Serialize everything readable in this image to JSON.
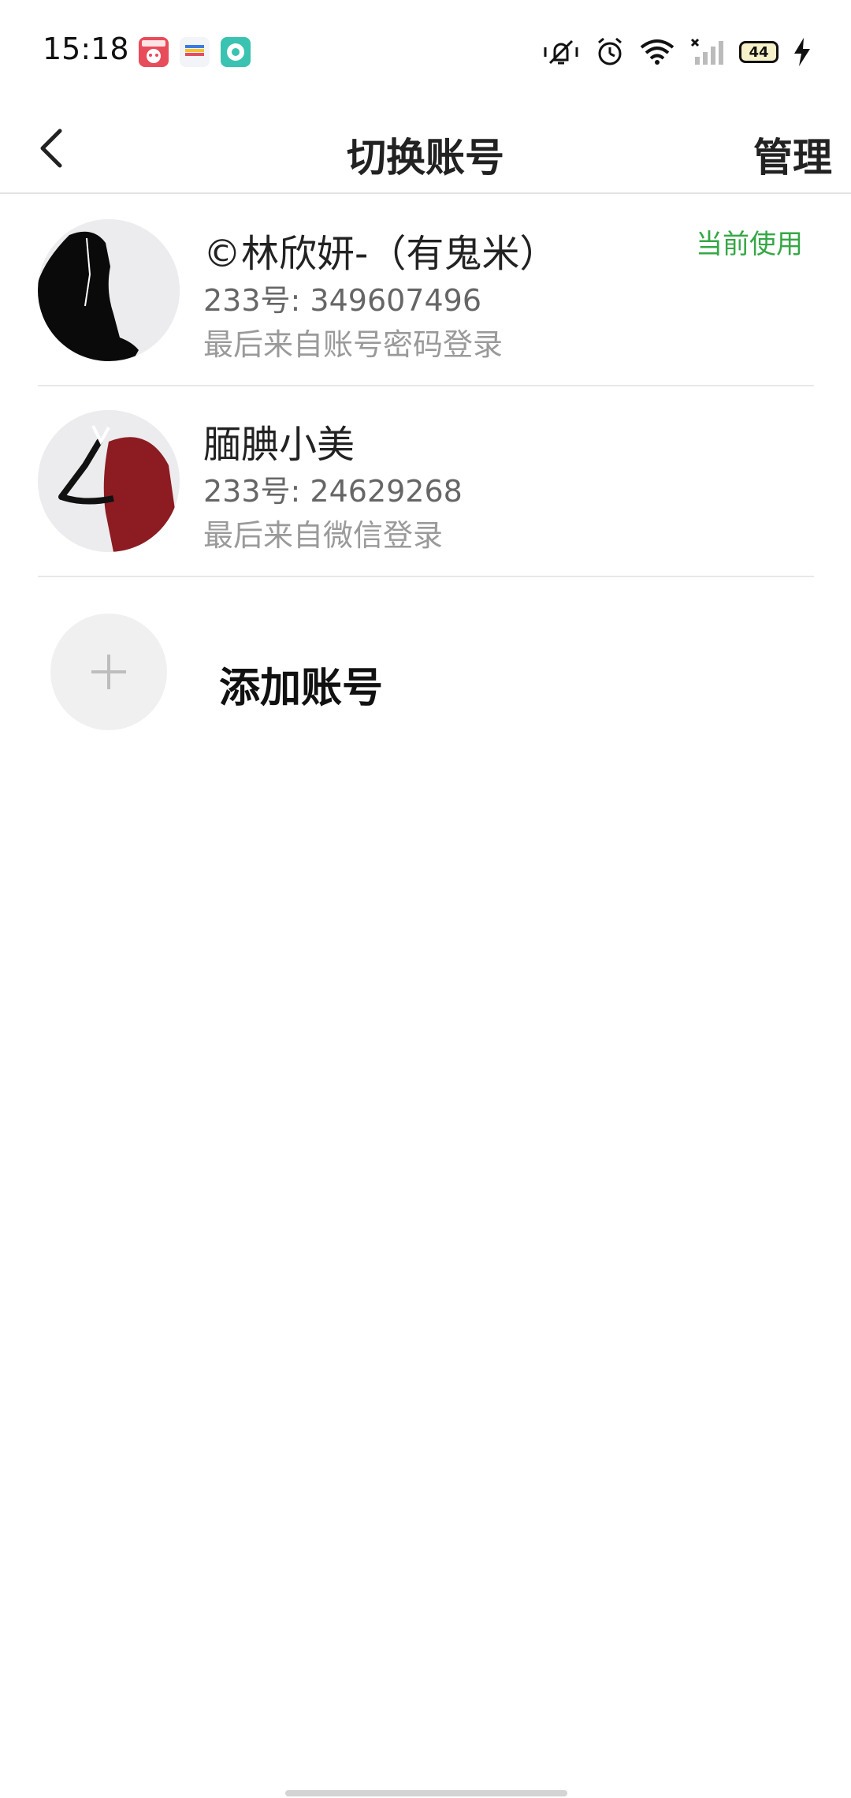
{
  "status_bar": {
    "time": "15:18",
    "battery_level": "44",
    "icons": [
      "app-icon-shopping",
      "app-icon-wallet",
      "app-icon-chat",
      "vibrate-icon",
      "alarm-icon",
      "wifi-icon",
      "signal-icon",
      "battery-icon",
      "charging-icon"
    ]
  },
  "header": {
    "title": "切换账号",
    "manage_label": "管理",
    "back_icon": "chevron-left-icon"
  },
  "accounts": [
    {
      "name": "©林欣妍-（有鬼米）",
      "id_text": "233号: 349607496",
      "login_text": "最后来自账号密码登录",
      "badge": "当前使用"
    },
    {
      "name": "腼腆小美",
      "id_text": "233号: 24629268",
      "login_text": "最后来自微信登录"
    }
  ],
  "add_account": {
    "label": "添加账号",
    "icon": "plus-icon"
  },
  "colors": {
    "accent_green": "#35a745",
    "divider": "#e8e8e8",
    "text_primary": "#222222",
    "text_secondary": "#666666",
    "text_tertiary": "#9a9a9a"
  }
}
